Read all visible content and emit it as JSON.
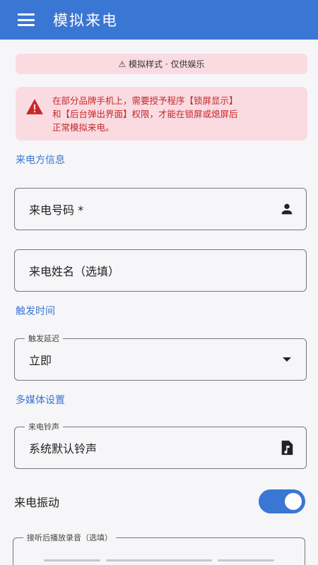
{
  "app": {
    "title": "模拟来电"
  },
  "style_banner": {
    "icon": "warning-icon",
    "text": "⚠ 模拟样式 · 仅供娱乐"
  },
  "alert": {
    "icon": "warning-triangle-icon",
    "line1": "在部分品牌手机上，需要授予程序【锁屏显示】",
    "line2": "和【后台弹出界面】权限，才能在锁屏或熄屏后",
    "line3": "正常模拟来电。"
  },
  "sections": {
    "caller_info": "来电方信息",
    "trigger_time": "触发时间",
    "media_settings": "多媒体设置"
  },
  "fields": {
    "caller_number": {
      "placeholder": "来电号码 *",
      "icon": "person-icon"
    },
    "caller_name": {
      "placeholder": "来电姓名（选填）"
    },
    "trigger_delay": {
      "label": "触发延迟",
      "value": "立即",
      "icon": "dropdown-arrow-icon"
    },
    "ringtone": {
      "label": "来电铃声",
      "value": "系统默认铃声",
      "icon": "music-file-icon"
    },
    "recording": {
      "label": "接听后播放录音（选填）"
    }
  },
  "vibration": {
    "label": "来电振动",
    "enabled": true
  },
  "colors": {
    "primary": "#3a76d3",
    "alert_bg": "#fadbe2",
    "alert_text": "#c62828"
  }
}
